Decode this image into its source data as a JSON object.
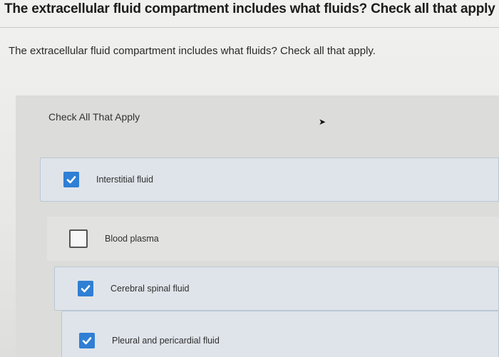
{
  "header": {
    "title": "The extracellular fluid compartment includes what fluids? Check all that apply"
  },
  "question": {
    "prompt": "The extracellular fluid compartment includes what fluids? Check all that apply."
  },
  "panel": {
    "instruction": "Check All That Apply"
  },
  "options": [
    {
      "label": "Interstitial fluid",
      "checked": true
    },
    {
      "label": "Blood plasma",
      "checked": false
    },
    {
      "label": "Cerebral spinal fluid",
      "checked": true
    },
    {
      "label": "Pleural and pericardial fluid",
      "checked": true
    }
  ],
  "colors": {
    "accent": "#2f7fd4",
    "selected_bg": "#dfe4ea"
  }
}
